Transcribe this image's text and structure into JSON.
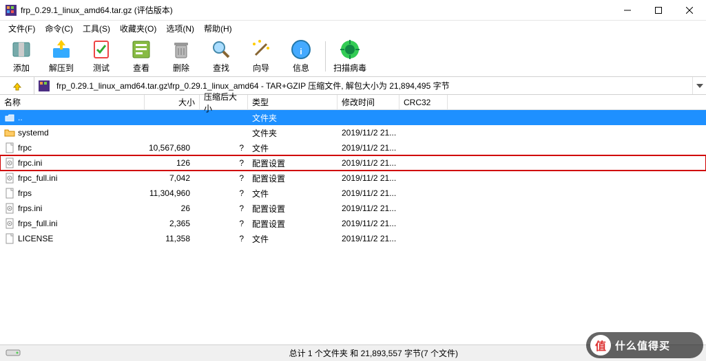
{
  "window": {
    "title": "frp_0.29.1_linux_amd64.tar.gz (评估版本)"
  },
  "menu": {
    "file": "文件(F)",
    "cmd": "命令(C)",
    "tool": "工具(S)",
    "fav": "收藏夹(O)",
    "opt": "选项(N)",
    "help": "帮助(H)"
  },
  "tools": {
    "add": "添加",
    "extract": "解压到",
    "test": "测试",
    "view": "查看",
    "delete": "删除",
    "find": "查找",
    "wizard": "向导",
    "info": "信息",
    "scan": "扫描病毒"
  },
  "path": "frp_0.29.1_linux_amd64.tar.gz\\frp_0.29.1_linux_amd64 - TAR+GZIP 压缩文件, 解包大小为 21,894,495 字节",
  "cols": {
    "name": "名称",
    "size": "大小",
    "packed": "压缩后大小",
    "type": "类型",
    "date": "修改时间",
    "crc": "CRC32"
  },
  "rows": [
    {
      "name": "..",
      "size": "",
      "packed": "",
      "type": "文件夹",
      "date": "",
      "icon": "up",
      "sel": true
    },
    {
      "name": "systemd",
      "size": "",
      "packed": "",
      "type": "文件夹",
      "date": "2019/11/2 21...",
      "icon": "folder"
    },
    {
      "name": "frpc",
      "size": "10,567,680",
      "packed": "?",
      "type": "文件",
      "date": "2019/11/2 21...",
      "icon": "file"
    },
    {
      "name": "frpc.ini",
      "size": "126",
      "packed": "?",
      "type": "配置设置",
      "date": "2019/11/2 21...",
      "icon": "ini",
      "hl": true
    },
    {
      "name": "frpc_full.ini",
      "size": "7,042",
      "packed": "?",
      "type": "配置设置",
      "date": "2019/11/2 21...",
      "icon": "ini"
    },
    {
      "name": "frps",
      "size": "11,304,960",
      "packed": "?",
      "type": "文件",
      "date": "2019/11/2 21...",
      "icon": "file"
    },
    {
      "name": "frps.ini",
      "size": "26",
      "packed": "?",
      "type": "配置设置",
      "date": "2019/11/2 21...",
      "icon": "ini"
    },
    {
      "name": "frps_full.ini",
      "size": "2,365",
      "packed": "?",
      "type": "配置设置",
      "date": "2019/11/2 21...",
      "icon": "ini"
    },
    {
      "name": "LICENSE",
      "size": "11,358",
      "packed": "?",
      "type": "文件",
      "date": "2019/11/2 21...",
      "icon": "file"
    }
  ],
  "status": "总计 1 个文件夹 和 21,893,557 字节(7 个文件)",
  "watermark": {
    "char": "值",
    "text": "什么值得买"
  }
}
